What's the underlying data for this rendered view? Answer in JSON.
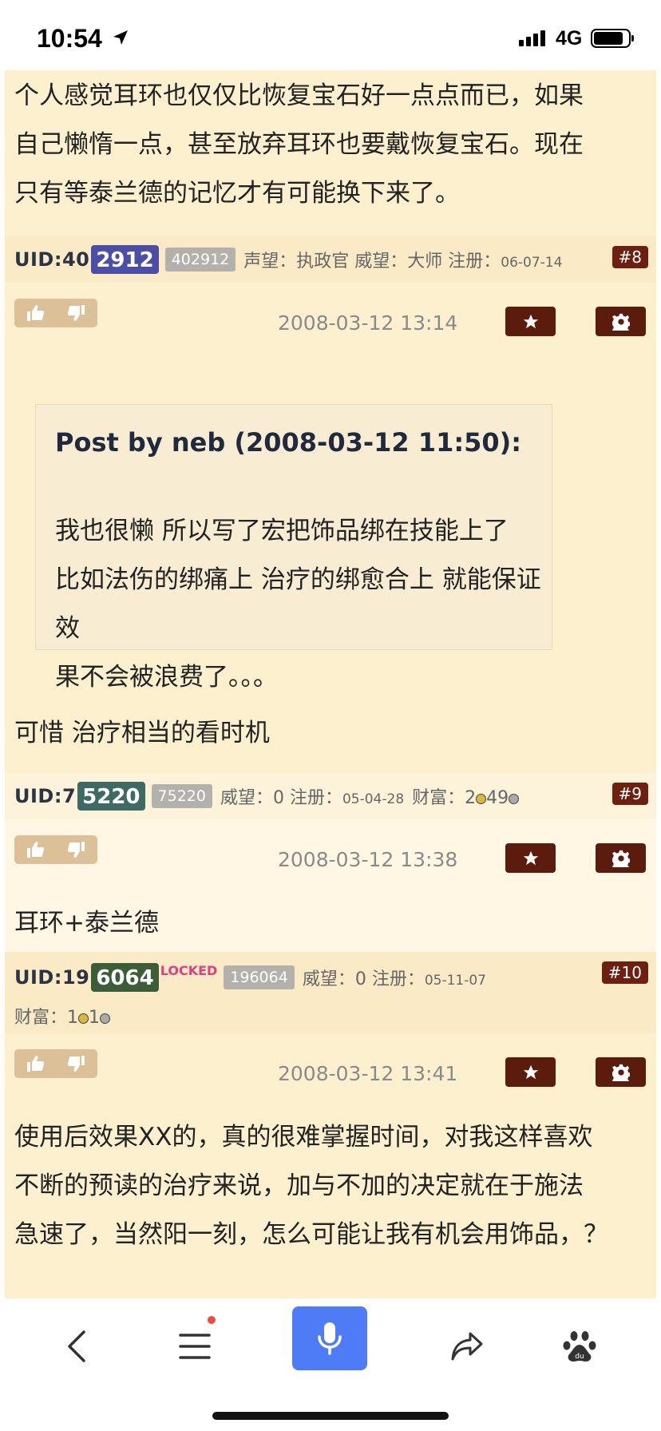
{
  "status_bar": {
    "time": "10:54",
    "network": "4G"
  },
  "posts": {
    "p7_text": [
      "个人感觉耳环也仅仅比恢复宝石好一点点而已，如果",
      "自己懒惰一点，甚至放弃耳环也要戴恢复宝石。现在",
      "只有等泰兰德的记忆才有可能换下来了。"
    ],
    "p8": {
      "uid_prefix": "UID:40",
      "uid_box": "2912",
      "uid_full": "402912",
      "meta": "声望：执政官 威望：大师 注册：",
      "reg_date": "06-07-14",
      "floor": "#8",
      "datetime": "2008-03-12 13:14",
      "quote_title": "Post by neb (2008-03-12 11:50):",
      "quote_lines": [
        "我也很懒 所以写了宏把饰品绑在技能上了",
        "比如法伤的绑痛上 治疗的绑愈合上 就能保证效",
        "果不会被浪费了。。。"
      ],
      "text": "可惜 治疗相当的看时机"
    },
    "p9": {
      "uid_prefix": "UID:7",
      "uid_box": "5220",
      "uid_full": "75220",
      "meta": "威望：0 注册：",
      "reg_date": "05-04-28",
      "wealth_label": "财富：",
      "wealth_a": "2",
      "wealth_b": "49",
      "floor": "#9",
      "datetime": "2008-03-12 13:38",
      "text": "耳环+泰兰德"
    },
    "p10": {
      "uid_prefix": "UID:19",
      "uid_box": "6064",
      "locked": "LOCKED",
      "uid_full": "196064",
      "meta": "威望：0 注册：",
      "reg_date": "05-11-07",
      "wealth_label": "财富：",
      "wealth_a": "1",
      "wealth_b": "1",
      "floor": "#10",
      "datetime": "2008-03-12 13:41",
      "text_lines": [
        "使用后效果XX的，真的很难掌握时间，对我这样喜欢",
        "不断的预读的治疗来说，加与不加的决定就在于施法",
        "急速了，当然阳一刻，怎么可能让我有机会用饰品，？"
      ]
    }
  },
  "colors": {
    "uid8": "#4a4ea6",
    "uid9": "#3d6a63",
    "uid10": "#3b5d38",
    "mic": "#4e7cf6"
  },
  "toolbar": {
    "icons": [
      "back-icon",
      "menu-icon",
      "microphone-icon",
      "share-icon",
      "baidu-paw-icon"
    ]
  }
}
